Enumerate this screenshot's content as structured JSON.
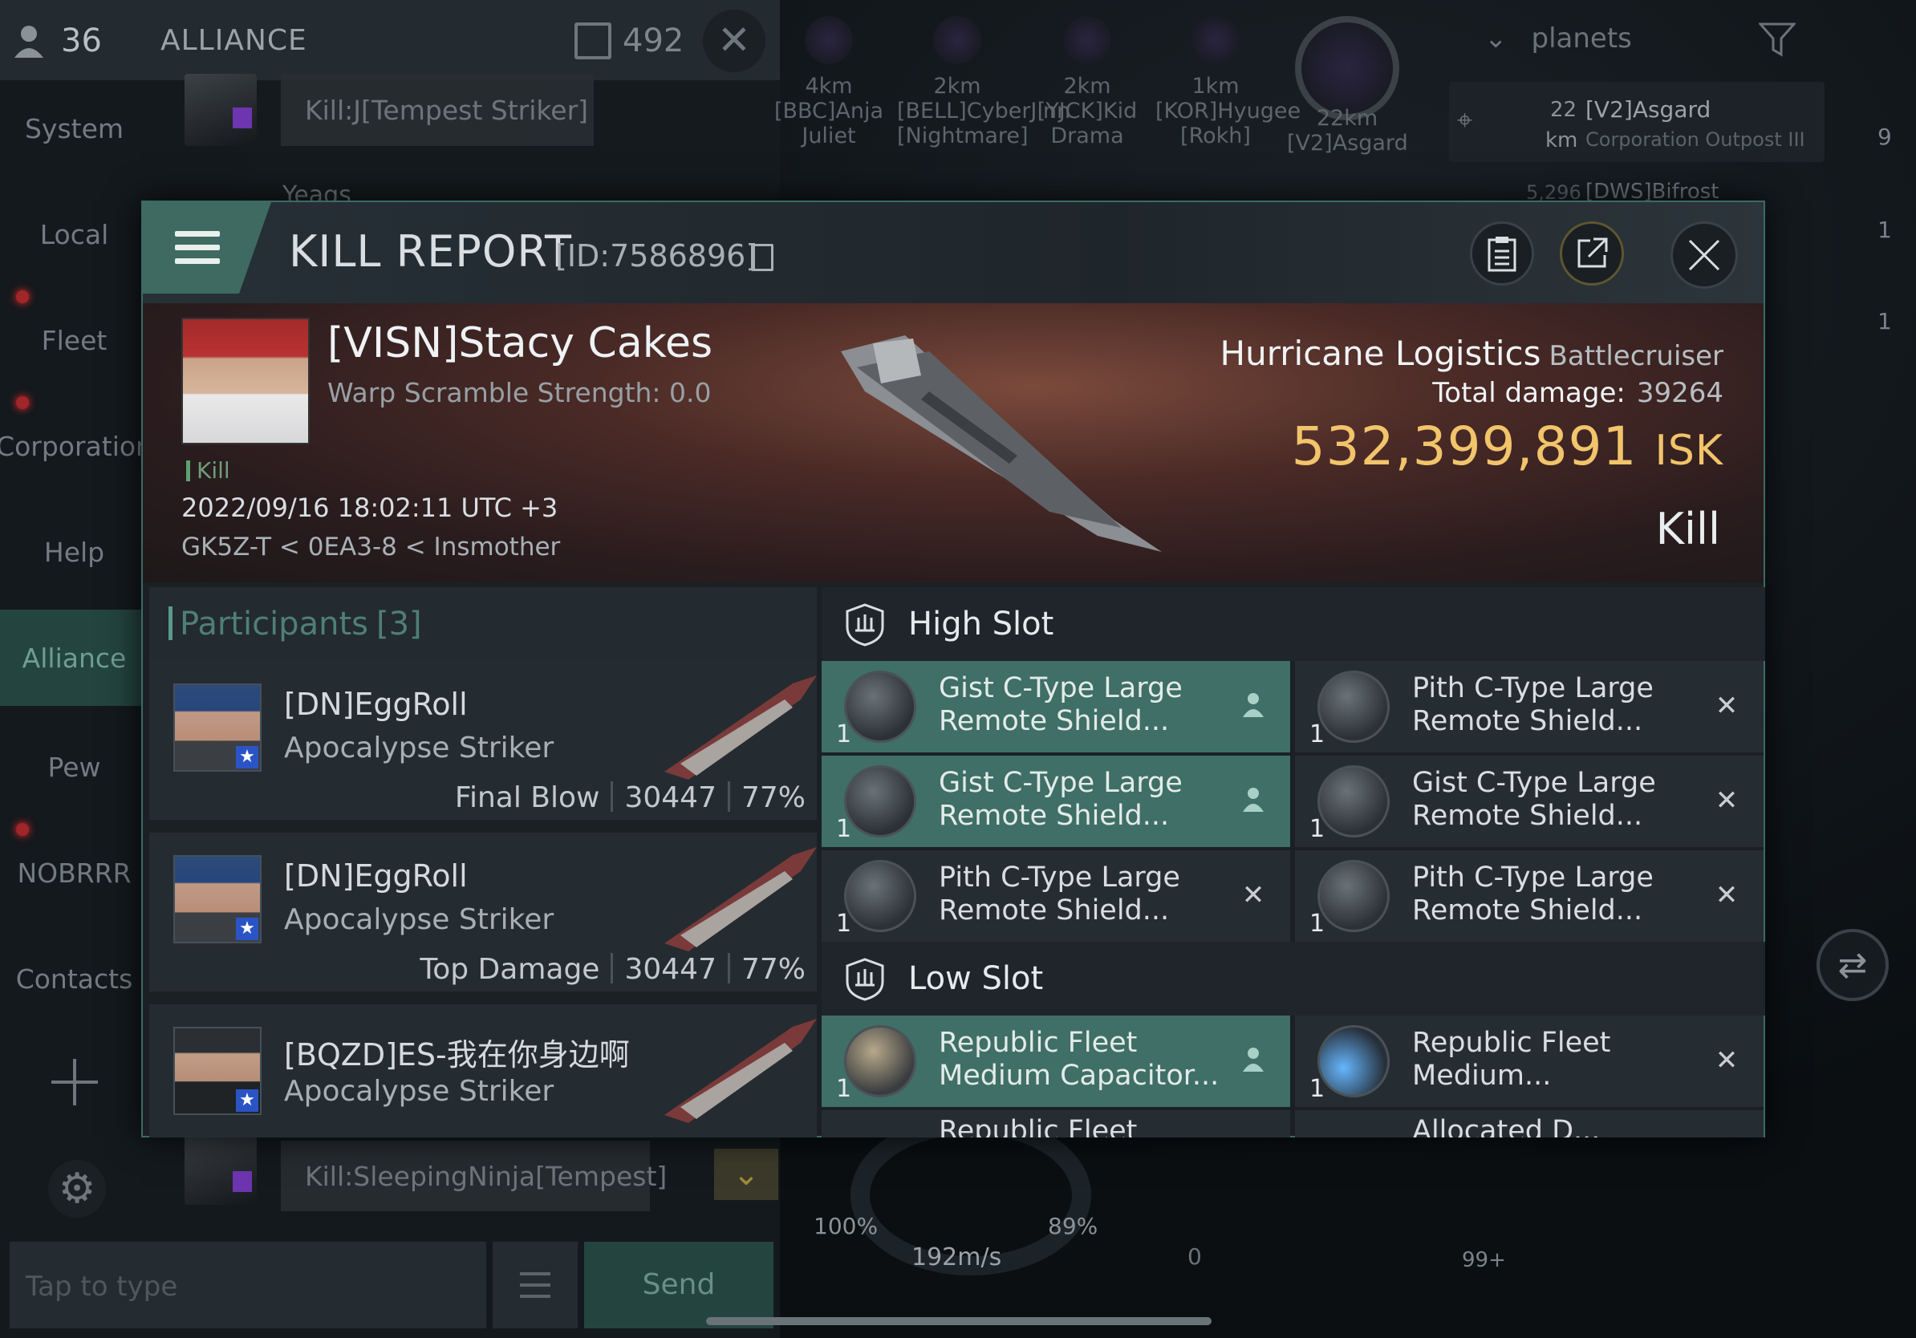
{
  "chat": {
    "member_count": "36",
    "channel": "ALLIANCE",
    "unread": "492",
    "nav": [
      {
        "label": "System"
      },
      {
        "label": "Local"
      },
      {
        "label": "Fleet"
      },
      {
        "label": "Corporation"
      },
      {
        "label": "Help"
      },
      {
        "label": "Alliance"
      },
      {
        "label": "Pew"
      },
      {
        "label": "NOBRRR"
      },
      {
        "label": "Contacts"
      }
    ],
    "messages": [
      {
        "text": "Kill:J[Tempest Striker]"
      },
      {
        "text": "Yeags"
      },
      {
        "text": "Kill:SleepingNinja[Tempest]"
      }
    ],
    "input_placeholder": "Tap to type",
    "send_label": "Send"
  },
  "targets": [
    {
      "distance": "4km",
      "name": "[BBC]Anja Juliet"
    },
    {
      "distance": "2km",
      "name": "[BELL]CyberJinn [Nightmare]"
    },
    {
      "distance": "2km",
      "name": "[YJCK]Kid Drama"
    },
    {
      "distance": "1km",
      "name": "[KOR]Hyugee [Rokh]"
    },
    {
      "distance": "22km",
      "name": "[V2]Asgard"
    }
  ],
  "overview": {
    "filter": "planets",
    "entry_distance": "22",
    "entry_unit": "km",
    "entry_name": "[V2]Asgard",
    "entry_sub": "Corporation Outpost III",
    "next_distance": "5,296",
    "next_name": "[DWS]Bifrost",
    "right_badges": [
      "9",
      "1",
      "1"
    ]
  },
  "hud": {
    "speed": "192m/s",
    "shield_pct": "100%",
    "armor_pct": "89%",
    "zero": "0",
    "badge": "99+"
  },
  "kill_report": {
    "title": "KILL REPORT",
    "id": "[ID:7586896]",
    "victim": {
      "name": "[VISN]Stacy Cakes",
      "warp": "Warp Scramble Strength: 0.0",
      "tag": "Kill",
      "date": "2022/09/16 18:02:11 UTC +3",
      "location": "GK5Z-T < 0EA3-8 < Insmother"
    },
    "ship": {
      "name": "Hurricane Logistics",
      "class": "Battlecruiser"
    },
    "total_damage_label": "Total damage:",
    "total_damage": "39264",
    "isk_value": "532,399,891",
    "isk_unit": "ISK",
    "result": "Kill",
    "participants_title": "Participants",
    "participants_count": "[3]",
    "participants": [
      {
        "name": "[DN]EggRoll",
        "ship": "Apocalypse Striker",
        "role": "Final Blow",
        "damage": "30447",
        "pct": "77%"
      },
      {
        "name": "[DN]EggRoll",
        "ship": "Apocalypse Striker",
        "role": "Top Damage",
        "damage": "30447",
        "pct": "77%"
      },
      {
        "name": "[BQZD]ES-我在你身边啊",
        "ship": "Apocalypse Striker",
        "role": "",
        "damage": "",
        "pct": ""
      }
    ],
    "high_slot_label": "High Slot",
    "low_slot_label": "Low Slot",
    "high_slots": [
      {
        "qty": "1",
        "line1": "Gist C-Type Large",
        "line2": "Remote Shield...",
        "fitted": true
      },
      {
        "qty": "1",
        "line1": "Pith C-Type Large",
        "line2": "Remote Shield...",
        "fitted": false
      },
      {
        "qty": "1",
        "line1": "Gist C-Type Large",
        "line2": "Remote Shield...",
        "fitted": true
      },
      {
        "qty": "1",
        "line1": "Gist C-Type Large",
        "line2": "Remote Shield...",
        "fitted": false
      },
      {
        "qty": "1",
        "line1": "Pith C-Type Large",
        "line2": "Remote Shield...",
        "fitted": false
      },
      {
        "qty": "1",
        "line1": "Pith C-Type Large",
        "line2": "Remote Shield...",
        "fitted": false
      }
    ],
    "low_slots": [
      {
        "qty": "1",
        "line1": "Republic Fleet",
        "line2": "Medium Capacitor...",
        "fitted": true
      },
      {
        "qty": "1",
        "line1": "Republic Fleet",
        "line2": "Medium...",
        "fitted": false
      },
      {
        "qty": "",
        "line1": "Republic Fleet",
        "line2": "",
        "fitted": false
      },
      {
        "qty": "",
        "line1": "Allocated D...",
        "line2": "",
        "fitted": false
      }
    ]
  },
  "colors": {
    "accent": "#3f6f66",
    "isk": "#f2c46b",
    "panel": "#1b2024"
  },
  "icons": [
    "hamburger-icon",
    "clipboard-icon",
    "share-icon",
    "close-icon",
    "copy-icon",
    "shield-slot-icon",
    "person-icon",
    "x-icon",
    "gear-icon",
    "plus-icon",
    "filter-icon",
    "chevron-down-icon"
  ]
}
